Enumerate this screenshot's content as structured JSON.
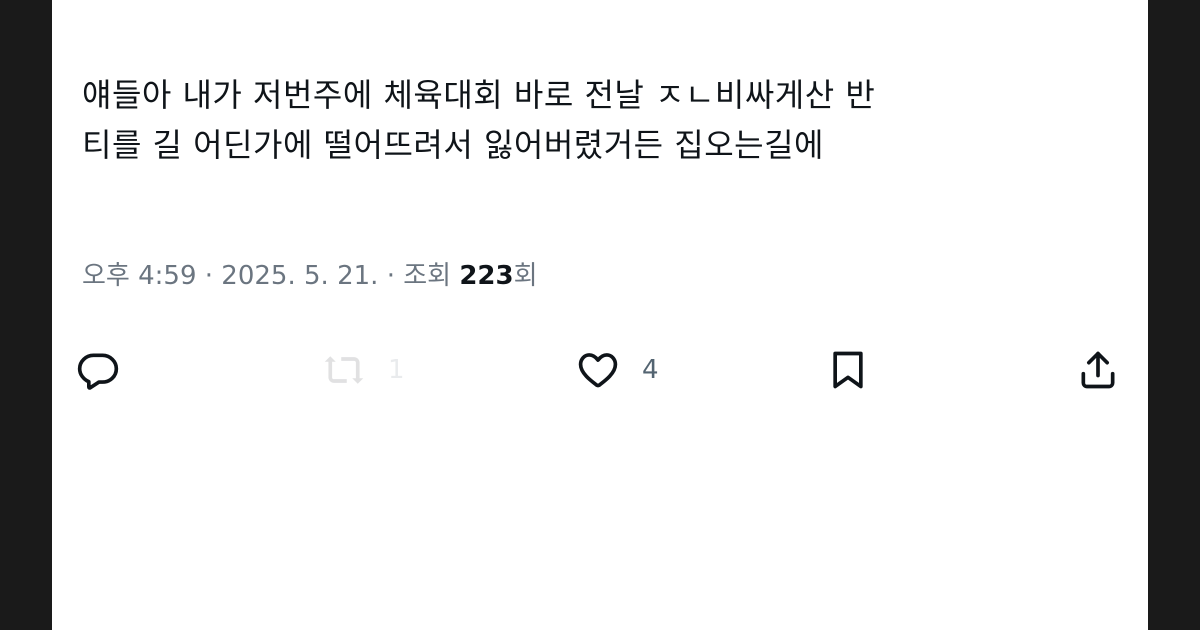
{
  "tweet": {
    "text_line1": "얘들아 내가 저번주에 체육대회 바로 전날 ㅈㄴ비싸게산 반",
    "text_line2": "티를 길 어딘가에 떨어뜨려서 잃어버렸거든 집오는길에"
  },
  "meta": {
    "time": "오후 4:59",
    "separator": "·",
    "date": "2025. 5. 21.",
    "views_label": "조회",
    "views_count": "223",
    "views_suffix": "회"
  },
  "actions": {
    "reply": {
      "icon": "reply-icon"
    },
    "retweet": {
      "icon": "retweet-icon",
      "count": "1"
    },
    "like": {
      "icon": "heart-icon",
      "count": "4"
    },
    "bookmark": {
      "icon": "bookmark-icon"
    },
    "share": {
      "icon": "share-icon"
    }
  },
  "colors": {
    "text": "#0f1419",
    "meta": "#6b7580",
    "icon": "#0f1419",
    "background": "#ffffff"
  }
}
